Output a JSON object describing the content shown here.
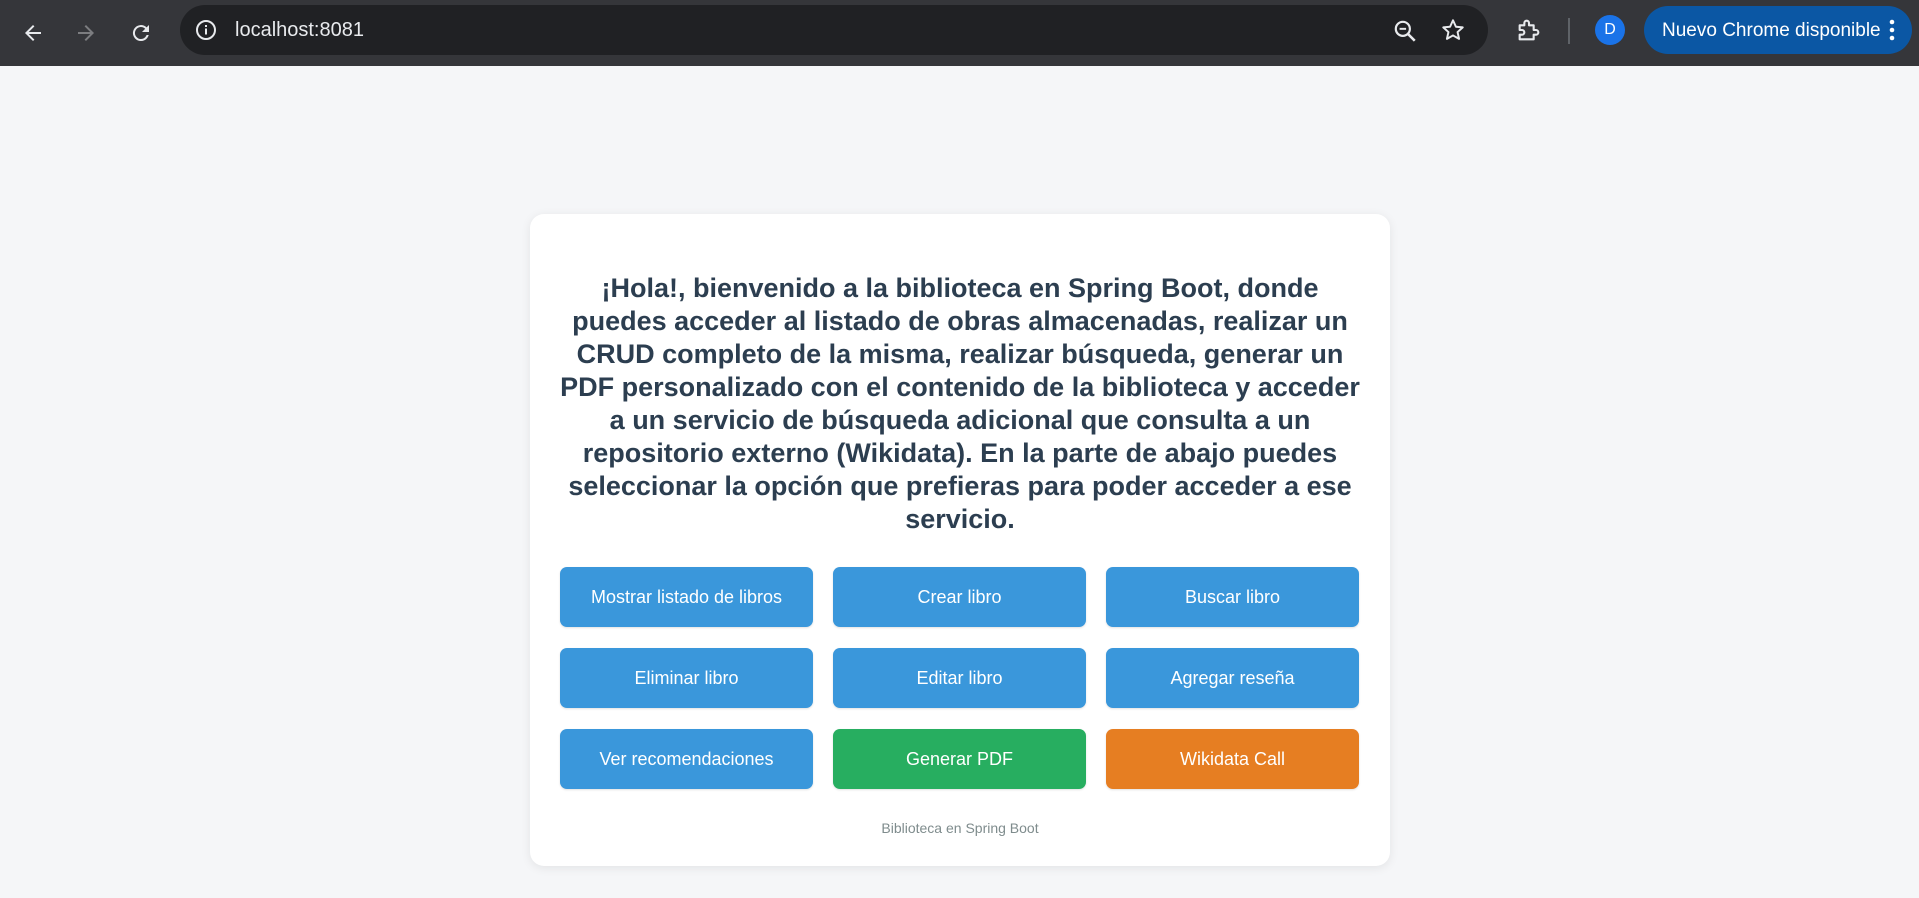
{
  "browser": {
    "url": "localhost:8081",
    "profile_initial": "D",
    "update_label": "Nuevo Chrome disponible",
    "icons": [
      "back-icon",
      "forward-icon",
      "reload-icon",
      "info-icon",
      "zoom-icon",
      "star-icon",
      "extensions-icon",
      "more-vert-icon"
    ]
  },
  "page": {
    "intro": "¡Hola!, bienvenido a la biblioteca en Spring Boot, donde puedes acceder al listado de obras almacenadas, realizar un CRUD completo de la misma, realizar búsqueda, generar un PDF personalizado con el contenido de la biblioteca y acceder a un servicio de búsqueda adicional que consulta a un repositorio externo (Wikidata). En la parte de abajo puedes seleccionar la opción que prefieras para poder acceder a ese servicio.",
    "buttons": [
      {
        "label": "Mostrar listado de libros",
        "color": "#3a97db"
      },
      {
        "label": "Crear libro",
        "color": "#3a97db"
      },
      {
        "label": "Buscar libro",
        "color": "#3a97db"
      },
      {
        "label": "Eliminar libro",
        "color": "#3a97db"
      },
      {
        "label": "Editar libro",
        "color": "#3a97db"
      },
      {
        "label": "Agregar reseña",
        "color": "#3a97db"
      },
      {
        "label": "Ver recomendaciones",
        "color": "#3a97db"
      },
      {
        "label": "Generar PDF",
        "color": "#27ae60"
      },
      {
        "label": "Wikidata Call",
        "color": "#e67e22"
      }
    ],
    "footer": "Biblioteca en Spring Boot"
  }
}
